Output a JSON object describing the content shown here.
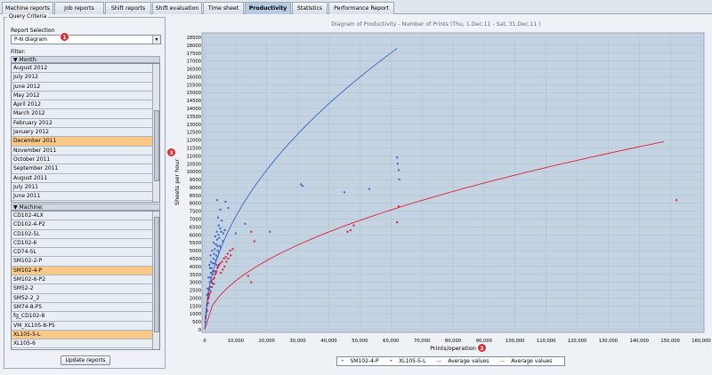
{
  "tabs": [
    {
      "label": "Machine reports",
      "active": false
    },
    {
      "label": "Job reports",
      "active": false
    },
    {
      "label": "Shift reports",
      "active": false
    },
    {
      "label": "Shift evaluation",
      "active": false
    },
    {
      "label": "Time sheet",
      "active": false
    },
    {
      "label": "Productivity",
      "active": true
    },
    {
      "label": "Statistics",
      "active": false
    },
    {
      "label": "Performance Report",
      "active": false
    }
  ],
  "query": {
    "title": "Query Criteria",
    "report_selection_label": "Report Selection",
    "report_selection_value": "P-N diagram",
    "filter_label": "Filter:",
    "month_header": "Month:",
    "months": [
      "August 2012",
      "July 2012",
      "June 2012",
      "May 2012",
      "April 2012",
      "March 2012",
      "February 2012",
      "January 2012",
      "December 2011",
      "November 2011",
      "October 2011",
      "September 2011",
      "August 2011",
      "July 2011",
      "June 2011"
    ],
    "selected_month": "December 2011",
    "machine_header": "Machine:",
    "machines": [
      "CD102-4LX",
      "CD102-4-P2",
      "CD102-5L",
      "CD102-6",
      "CD74-5L",
      "SM102-2-P",
      "SM102-4-P",
      "SM102-6-P2",
      "SM52-2",
      "SM52-2_2",
      "SM74-8-P5",
      "fg_CD102-8",
      "VM_XL105-8-P5",
      "XL105-5-L",
      "XL105-6"
    ],
    "selected_machines": [
      "SM102-4-P",
      "XL105-5-L"
    ],
    "update_button": "Update reports"
  },
  "badges": [
    "1",
    "2",
    "3"
  ],
  "chart_data": {
    "type": "scatter",
    "title": "Diagram of Productivity - Number of Prints   (Thu, 1.Dec.11 - Sat, 31.Dec.11 )",
    "xlabel": "Prints/operation",
    "ylabel": "Sheets per hour",
    "xlim": [
      0,
      160000
    ],
    "ylim": [
      0,
      18500
    ],
    "x_ticks": [
      "0",
      "10,000",
      "20,000",
      "30,000",
      "40,000",
      "50,000",
      "60,000",
      "70,000",
      "80,000",
      "90,000",
      "100,000",
      "110,000",
      "120,000",
      "130,000",
      "140,000",
      "150,000",
      "160,000"
    ],
    "y_ticks": [
      "0",
      "500",
      "1000",
      "1500",
      "2000",
      "2500",
      "3000",
      "3500",
      "4000",
      "4500",
      "5000",
      "5500",
      "6000",
      "6500",
      "7000",
      "7500",
      "8000",
      "8500",
      "9000",
      "9500",
      "10000",
      "10500",
      "11000",
      "11500",
      "12000",
      "12500",
      "13000",
      "13500",
      "14000",
      "14500",
      "15000",
      "15500",
      "16000",
      "16500",
      "17000",
      "17500",
      "18000",
      "18500"
    ],
    "grid": true,
    "colors": {
      "SM102-4-P": "#3c64c8",
      "XL105-5-L": "#dd2233",
      "plot_bg": "#c4d3e2"
    },
    "series": [
      {
        "name": "SM102-4-P",
        "kind": "points",
        "points": [
          [
            200,
            500
          ],
          [
            400,
            900
          ],
          [
            600,
            1200
          ],
          [
            800,
            1600
          ],
          [
            1000,
            2000
          ],
          [
            1200,
            2300
          ],
          [
            1400,
            2600
          ],
          [
            1600,
            3000
          ],
          [
            1800,
            3300
          ],
          [
            2000,
            3600
          ],
          [
            2200,
            3900
          ],
          [
            2500,
            4200
          ],
          [
            2800,
            4500
          ],
          [
            3000,
            4800
          ],
          [
            3300,
            5100
          ],
          [
            3600,
            5400
          ],
          [
            4000,
            5700
          ],
          [
            4400,
            6000
          ],
          [
            5000,
            6400
          ],
          [
            5500,
            6900
          ],
          [
            3000,
            2900
          ],
          [
            2500,
            3500
          ],
          [
            3500,
            4400
          ],
          [
            4200,
            5000
          ],
          [
            4800,
            5300
          ],
          [
            2000,
            4300
          ],
          [
            1700,
            3900
          ],
          [
            2300,
            2700
          ],
          [
            2700,
            3200
          ],
          [
            3200,
            3700
          ],
          [
            3800,
            4100
          ],
          [
            4100,
            4600
          ],
          [
            4600,
            4900
          ],
          [
            5200,
            5200
          ],
          [
            5800,
            5600
          ],
          [
            6000,
            6100
          ],
          [
            6500,
            6300
          ],
          [
            4300,
            7100
          ],
          [
            5000,
            7600
          ],
          [
            4000,
            8200
          ],
          [
            6700,
            8100
          ],
          [
            7600,
            7700
          ],
          [
            1200,
            3300
          ],
          [
            900,
            2600
          ],
          [
            700,
            2200
          ],
          [
            1500,
            4100
          ],
          [
            1900,
            4700
          ],
          [
            2400,
            5000
          ],
          [
            2900,
            5500
          ],
          [
            3400,
            5900
          ],
          [
            3900,
            6200
          ],
          [
            4500,
            6600
          ],
          [
            800,
            1200
          ],
          [
            1100,
            1700
          ],
          [
            1300,
            2100
          ],
          [
            1600,
            2500
          ],
          [
            2100,
            3100
          ],
          [
            2600,
            3700
          ],
          [
            3100,
            4200
          ],
          [
            3700,
            4700
          ],
          [
            4100,
            5300
          ],
          [
            4700,
            5800
          ],
          [
            5300,
            6200
          ],
          [
            300,
            700
          ],
          [
            500,
            1100
          ],
          [
            700,
            1500
          ],
          [
            10000,
            6100
          ],
          [
            13000,
            6700
          ],
          [
            21000,
            6200
          ],
          [
            31000,
            9200
          ],
          [
            31500,
            9100
          ],
          [
            45000,
            8700
          ],
          [
            53000,
            8900
          ],
          [
            62000,
            10900
          ],
          [
            62200,
            10500
          ],
          [
            62500,
            10100
          ],
          [
            62700,
            9500
          ]
        ]
      },
      {
        "name": "XL105-5-L",
        "kind": "points",
        "points": [
          [
            300,
            800
          ],
          [
            600,
            1300
          ],
          [
            900,
            1700
          ],
          [
            1200,
            2000
          ],
          [
            1500,
            2300
          ],
          [
            1900,
            2700
          ],
          [
            2300,
            3000
          ],
          [
            2800,
            3200
          ],
          [
            3300,
            3500
          ],
          [
            3800,
            3700
          ],
          [
            4300,
            4000
          ],
          [
            5000,
            4200
          ],
          [
            5600,
            4300
          ],
          [
            6200,
            4500
          ],
          [
            6800,
            4600
          ],
          [
            7400,
            4800
          ],
          [
            8200,
            5000
          ],
          [
            9000,
            5100
          ],
          [
            2000,
            2400
          ],
          [
            2600,
            2900
          ],
          [
            3100,
            3300
          ],
          [
            3600,
            3600
          ],
          [
            4100,
            3900
          ],
          [
            4600,
            4100
          ],
          [
            5200,
            3600
          ],
          [
            5800,
            3800
          ],
          [
            6400,
            4000
          ],
          [
            7000,
            4300
          ],
          [
            7600,
            4500
          ],
          [
            8400,
            4700
          ],
          [
            1000,
            1900
          ],
          [
            1400,
            2200
          ],
          [
            15000,
            6200
          ],
          [
            14000,
            3400
          ],
          [
            15000,
            3000
          ],
          [
            16000,
            5600
          ],
          [
            46000,
            6200
          ],
          [
            47000,
            6300
          ],
          [
            48000,
            6600
          ],
          [
            62000,
            6800
          ],
          [
            62500,
            7800
          ],
          [
            152000,
            8200
          ]
        ]
      },
      {
        "name": "SM102-4-P Average values",
        "kind": "curve",
        "x_end": 62000,
        "y_end": 17800
      },
      {
        "name": "XL105-5-L Average values",
        "kind": "curve",
        "x_end": 148000,
        "y_end": 11900
      }
    ],
    "legend": [
      {
        "symbol": "•",
        "label": "SM102-4-P"
      },
      {
        "symbol": "•",
        "label": "XL105-5-L"
      },
      {
        "symbol": "—",
        "label": "Average values"
      },
      {
        "symbol": "—",
        "label": "Average values"
      }
    ],
    "legend_position": "bottom-center"
  }
}
